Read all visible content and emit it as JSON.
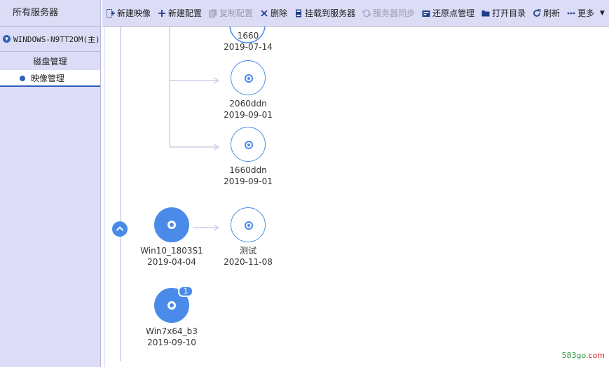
{
  "sidebar": {
    "title": "所有服务器",
    "server": "WINDOWS-N9TT2OM(主)",
    "disk_management": "磁盘管理",
    "image_management": "映像管理"
  },
  "toolbar": {
    "new_image": "新建映像",
    "new_config": "新建配置",
    "copy_config": "复制配置",
    "delete": "删除",
    "mount": "挂载到服务器",
    "sync": "服务器同步",
    "restore": "还原点管理",
    "open_dir": "打开目录",
    "refresh": "刷新",
    "more": "更多"
  },
  "nodes": {
    "n1660": {
      "name": "1660",
      "date": "2019-07-14"
    },
    "n2060ddn": {
      "name": "2060ddn",
      "date": "2019-09-01"
    },
    "n1660ddn": {
      "name": "1660ddn",
      "date": "2019-09-01"
    },
    "win10": {
      "name": "Win10_1803S1",
      "date": "2019-04-04"
    },
    "ceshi": {
      "name": "测试",
      "date": "2020-11-08"
    },
    "win7": {
      "name": "Win7x64_b3",
      "date": "2019-09-10",
      "badge": "1"
    }
  },
  "watermark": {
    "green": "583go",
    "red": ".com"
  },
  "colors": {
    "accent": "#4a8bea",
    "sidebar_bg": "#dcdcf7",
    "toolbar_icon": "#1f3f88"
  }
}
